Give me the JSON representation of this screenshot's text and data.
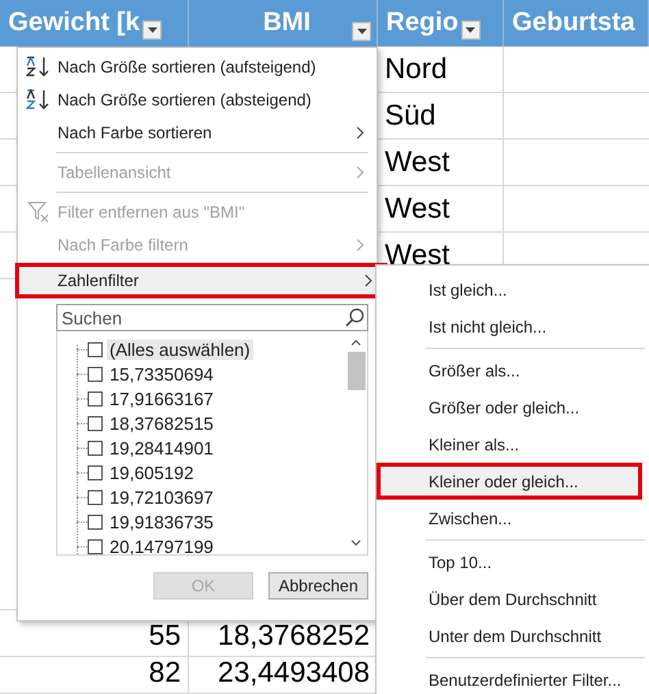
{
  "sheet": {
    "columns": [
      {
        "label": "Gewicht [k",
        "filter_button": true
      },
      {
        "label": "BMI",
        "filter_button": true
      },
      {
        "label": "Regio",
        "filter_button": true
      },
      {
        "label": "Geburtsta",
        "filter_button": false
      }
    ],
    "top_rows": [
      {
        "region": "Nord"
      },
      {
        "region": "Süd"
      },
      {
        "region": "West"
      },
      {
        "region": "West"
      },
      {
        "region": "West"
      }
    ],
    "bottom_rows": [
      {
        "weight": "55",
        "bmi": "18,3768252"
      },
      {
        "weight": "82",
        "bmi": "23,4493408"
      }
    ]
  },
  "filter_menu": {
    "items": [
      {
        "kind": "sort_asc",
        "label": "Nach Größe sortieren (aufsteigend)",
        "disabled": false,
        "submenu": false,
        "highlighted": false
      },
      {
        "kind": "sort_desc",
        "label": "Nach Größe sortieren (absteigend)",
        "disabled": false,
        "submenu": false,
        "highlighted": false
      },
      {
        "kind": "item",
        "label": "Nach Farbe sortieren",
        "disabled": false,
        "submenu": true,
        "highlighted": false
      },
      {
        "kind": "separator"
      },
      {
        "kind": "item",
        "label": "Tabellenansicht",
        "disabled": true,
        "submenu": true,
        "highlighted": false
      },
      {
        "kind": "separator"
      },
      {
        "kind": "clear_filter",
        "label": "Filter entfernen aus \"BMI\"",
        "disabled": true,
        "submenu": false,
        "highlighted": false
      },
      {
        "kind": "item",
        "label": "Nach Farbe filtern",
        "disabled": true,
        "submenu": true,
        "highlighted": false
      },
      {
        "kind": "item",
        "label": "Zahlenfilter",
        "disabled": false,
        "submenu": true,
        "highlighted": true
      }
    ],
    "search": {
      "placeholder": "Suchen"
    },
    "values": [
      {
        "label": "(Alles auswählen)",
        "checked": false,
        "selected": true
      },
      {
        "label": "15,73350694",
        "checked": false,
        "selected": false
      },
      {
        "label": "17,91663167",
        "checked": false,
        "selected": false
      },
      {
        "label": "18,37682515",
        "checked": false,
        "selected": false
      },
      {
        "label": "19,28414901",
        "checked": false,
        "selected": false
      },
      {
        "label": "19,605192",
        "checked": false,
        "selected": false
      },
      {
        "label": "19,72103697",
        "checked": false,
        "selected": false
      },
      {
        "label": "19,91836735",
        "checked": false,
        "selected": false
      },
      {
        "label": "20,14797199",
        "checked": false,
        "selected": false
      }
    ],
    "buttons": [
      {
        "label": "OK",
        "disabled": true
      },
      {
        "label": "Abbrechen",
        "disabled": false
      }
    ]
  },
  "number_filter_menu": {
    "items": [
      {
        "kind": "item",
        "label": "Ist gleich...",
        "highlighted": false
      },
      {
        "kind": "item",
        "label": "Ist nicht gleich...",
        "highlighted": false
      },
      {
        "kind": "separator"
      },
      {
        "kind": "item",
        "label": "Größer als...",
        "highlighted": false
      },
      {
        "kind": "item",
        "label": "Größer oder gleich...",
        "highlighted": false
      },
      {
        "kind": "item",
        "label": "Kleiner als...",
        "highlighted": false
      },
      {
        "kind": "item",
        "label": "Kleiner oder gleich...",
        "highlighted": true
      },
      {
        "kind": "item",
        "label": "Zwischen...",
        "highlighted": false
      },
      {
        "kind": "separator"
      },
      {
        "kind": "item",
        "label": "Top 10...",
        "highlighted": false
      },
      {
        "kind": "item",
        "label": "Über dem Durchschnitt",
        "highlighted": false
      },
      {
        "kind": "item",
        "label": "Unter dem Durchschnitt",
        "highlighted": false
      },
      {
        "kind": "separator"
      },
      {
        "kind": "item",
        "label": "Benutzerdefinierter Filter...",
        "highlighted": false
      }
    ]
  }
}
